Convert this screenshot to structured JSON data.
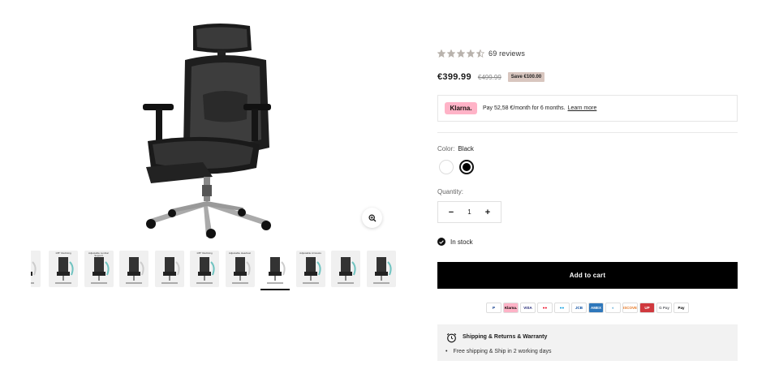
{
  "gallery": {
    "main_alt": "Black ergonomic mesh office chair",
    "zoom_icon": "zoom-in-icon",
    "thumbnails": [
      {
        "label": ""
      },
      {
        "label": "135° Reclining"
      },
      {
        "label": "Adjustable Lumbar Support"
      },
      {
        "label": ""
      },
      {
        "label": ""
      },
      {
        "label": "135° Reclining"
      },
      {
        "label": "Adjustable Headrest"
      },
      {
        "label": ""
      },
      {
        "label": "Adjustable Armrests"
      },
      {
        "label": ""
      },
      {
        "label": ""
      }
    ],
    "active_index": 7
  },
  "rating": {
    "stars": 4.5,
    "reviews_text": "69 reviews",
    "star_color": "#b9b3ad"
  },
  "price": {
    "current": "€399.99",
    "compare": "€499.99",
    "save": "Save €100.00"
  },
  "klarna": {
    "logo": "Klarna.",
    "text": "Pay 52,58 €/month for 6 months.",
    "link": "Learn more"
  },
  "color": {
    "label": "Color:",
    "value": "Black",
    "options": [
      "White",
      "Black"
    ]
  },
  "quantity": {
    "label": "Quantity:",
    "value": "1",
    "minus": "−",
    "plus": "+"
  },
  "stock": {
    "text": "In stock"
  },
  "cart": {
    "label": "Add to cart"
  },
  "payments": [
    "PayPal",
    "Klarna.",
    "VISA",
    "Mastercard",
    "Maestro",
    "JCB",
    "AMEX",
    "Diners",
    "DISCOVER",
    "UnionPay",
    "G Pay",
    "Apple Pay"
  ],
  "shipping": {
    "title": "Shipping & Returns & Warranty",
    "items": [
      "Free shipping & Ship in 2 working days"
    ]
  }
}
